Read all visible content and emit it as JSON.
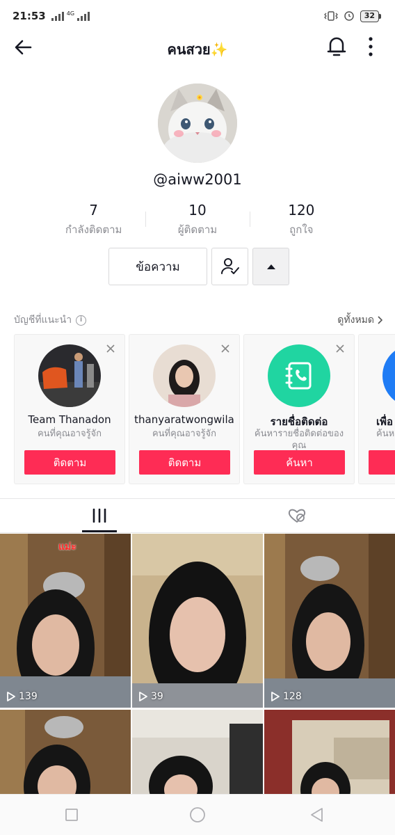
{
  "status_bar": {
    "time": "21:53",
    "network_label": "4G",
    "battery_level": "32"
  },
  "header": {
    "title": "คนสวย",
    "title_emoji": "✨"
  },
  "profile": {
    "username": "@aiww2001",
    "stats": [
      {
        "value": "7",
        "label": "กำลังติดตาม"
      },
      {
        "value": "10",
        "label": "ผู้ติดตาม"
      },
      {
        "value": "120",
        "label": "ถูกใจ"
      }
    ],
    "message_label": "ข้อความ"
  },
  "suggested": {
    "title": "บัญชีที่แนะนำ",
    "see_all_label": "ดูทั้งหมด",
    "cards": [
      {
        "name": "Team Thanadon",
        "subtitle": "คนที่คุณอาจรู้จัก",
        "button": "ติดตาม"
      },
      {
        "name": "thanyaratwongwila",
        "subtitle": "คนที่คุณอาจรู้จัก",
        "button": "ติดตาม"
      },
      {
        "name": "รายชื่อติดต่อ",
        "subtitle": "ค้นหารายชื่อติดต่อของคุณ",
        "button": "ค้นหา"
      },
      {
        "name": "เพื่อ",
        "subtitle": "ค้นหา",
        "button": ""
      }
    ]
  },
  "videos": [
    {
      "plays": "139",
      "caption": "แม่ะ"
    },
    {
      "plays": "39",
      "caption": ""
    },
    {
      "plays": "128",
      "caption": ""
    },
    {
      "plays": "",
      "caption": ""
    },
    {
      "plays": "",
      "caption": ""
    },
    {
      "plays": "",
      "caption": ""
    }
  ],
  "colors": {
    "accent": "#fe2c55",
    "contact_green": "#20d5a1",
    "text_primary": "#161823",
    "text_secondary": "#8a8b91"
  }
}
